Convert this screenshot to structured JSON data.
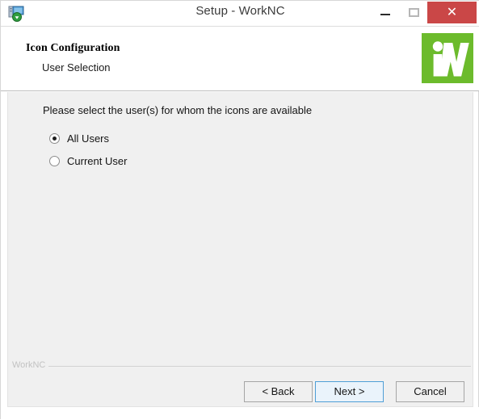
{
  "window": {
    "title": "Setup - WorkNC",
    "icon": "installer-icon",
    "controls": {
      "minimize_label": "—",
      "maximize_label": "",
      "close_label": "✕"
    },
    "close_color": "#ca4747"
  },
  "header": {
    "title": "Icon Configuration",
    "subtitle": "User Selection",
    "logo": {
      "name": "worknc-logo",
      "text": "iW",
      "background": "#6cbb2c",
      "foreground": "#ffffff"
    }
  },
  "main": {
    "prompt": "Please select the user(s) for whom the icons are available",
    "radio_group": {
      "name": "user-selection",
      "options": [
        {
          "label": "All Users",
          "selected": true
        },
        {
          "label": "Current User",
          "selected": false
        }
      ]
    }
  },
  "footer": {
    "brand": "WorkNC",
    "buttons": {
      "back": "< Back",
      "next": "Next >",
      "cancel": "Cancel"
    },
    "focused_button": "next",
    "focus_color": "#4f9fd6"
  }
}
